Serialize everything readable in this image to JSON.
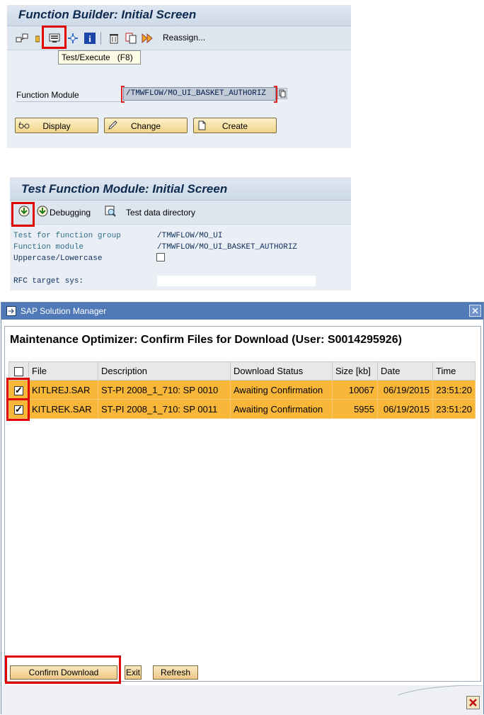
{
  "function_builder": {
    "title": "Function Builder: Initial Screen",
    "toolbar": {
      "reassign_label": "Reassign..."
    },
    "tooltip": "Test/Execute   (F8)",
    "field_label": "Function Module",
    "field_value": "/TMWFLOW/MO_UI_BASKET_AUTHORIZ",
    "buttons": {
      "display": "Display",
      "change": "Change",
      "create": "Create"
    }
  },
  "test_function": {
    "title": "Test Function Module: Initial Screen",
    "toolbar": {
      "debugging": "Debugging",
      "test_data": "Test data directory"
    },
    "rows": [
      {
        "label": "Test for function group",
        "value": "/TMWFLOW/MO_UI"
      },
      {
        "label": "Function module",
        "value": "/TMWFLOW/MO_UI_BASKET_AUTHORIZ"
      },
      {
        "label": "Uppercase/Lowercase"
      },
      {
        "label": "RFC target sys:"
      }
    ]
  },
  "solution_manager": {
    "window_title": "SAP Solution Manager",
    "heading": "Maintenance Optimizer: Confirm Files for Download (User: S0014295926)",
    "columns": [
      "File",
      "Description",
      "Download Status",
      "Size [kb]",
      "Date",
      "Time"
    ],
    "rows": [
      {
        "file": "KITLREJ.SAR",
        "description": "ST-PI 2008_1_710: SP 0010",
        "status": "Awaiting Confirmation",
        "size": "10067",
        "date": "06/19/2015",
        "time": "23:51:20"
      },
      {
        "file": "KITLREK.SAR",
        "description": "ST-PI 2008_1_710: SP 0011",
        "status": "Awaiting Confirmation",
        "size": "5955",
        "date": "06/19/2015",
        "time": "23:51:20"
      }
    ],
    "buttons": {
      "confirm": "Confirm Download",
      "exit": "Exit",
      "refresh": "Refresh"
    }
  },
  "colors": {
    "highlight": "#e00000",
    "row": "#f9b73a",
    "title_bar": "#4f79b7"
  }
}
